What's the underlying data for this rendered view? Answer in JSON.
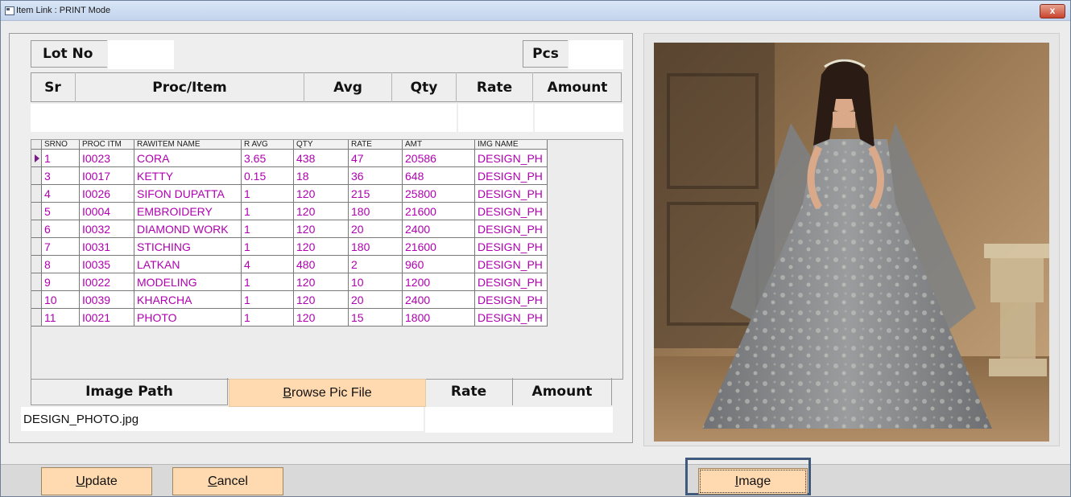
{
  "window": {
    "title": "Item Link : PRINT Mode",
    "close_symbol": "x"
  },
  "form": {
    "lot_no_label": "Lot No",
    "lot_no_value": "",
    "pcs_label": "Pcs",
    "pcs_value": ""
  },
  "header_row": {
    "sr": "Sr",
    "proc_item": "Proc/Item",
    "avg": "Avg",
    "qty": "Qty",
    "rate": "Rate",
    "amount": "Amount"
  },
  "grid": {
    "columns": [
      "SRNO",
      "PROC ITM",
      "RAWITEM NAME",
      "R AVG",
      "QTY",
      "RATE",
      "AMT",
      "IMG NAME"
    ],
    "rows": [
      {
        "srno": "1",
        "proc": "I0023",
        "name": "CORA",
        "avg": "3.65",
        "qty": "438",
        "rate": "47",
        "amt": "20586",
        "img": "DESIGN_PH"
      },
      {
        "srno": "3",
        "proc": "I0017",
        "name": "KETTY",
        "avg": "0.15",
        "qty": "18",
        "rate": "36",
        "amt": "648",
        "img": "DESIGN_PH"
      },
      {
        "srno": "4",
        "proc": "I0026",
        "name": "SIFON DUPATTA",
        "avg": "1",
        "qty": "120",
        "rate": "215",
        "amt": "25800",
        "img": "DESIGN_PH"
      },
      {
        "srno": "5",
        "proc": "I0004",
        "name": "EMBROIDERY",
        "avg": "1",
        "qty": "120",
        "rate": "180",
        "amt": "21600",
        "img": "DESIGN_PH"
      },
      {
        "srno": "6",
        "proc": "I0032",
        "name": "DIAMOND WORK",
        "avg": "1",
        "qty": "120",
        "rate": "20",
        "amt": "2400",
        "img": "DESIGN_PH"
      },
      {
        "srno": "7",
        "proc": "I0031",
        "name": "STICHING",
        "avg": "1",
        "qty": "120",
        "rate": "180",
        "amt": "21600",
        "img": "DESIGN_PH"
      },
      {
        "srno": "8",
        "proc": "I0035",
        "name": "LATKAN",
        "avg": "4",
        "qty": "480",
        "rate": "2",
        "amt": "960",
        "img": "DESIGN_PH"
      },
      {
        "srno": "9",
        "proc": "I0022",
        "name": "MODELING",
        "avg": "1",
        "qty": "120",
        "rate": "10",
        "amt": "1200",
        "img": "DESIGN_PH"
      },
      {
        "srno": "10",
        "proc": "I0039",
        "name": "KHARCHA",
        "avg": "1",
        "qty": "120",
        "rate": "20",
        "amt": "2400",
        "img": "DESIGN_PH"
      },
      {
        "srno": "11",
        "proc": "I0021",
        "name": "PHOTO",
        "avg": "1",
        "qty": "120",
        "rate": "15",
        "amt": "1800",
        "img": "DESIGN_PH"
      }
    ]
  },
  "footer_section": {
    "image_path_label": "Image Path",
    "browse_button": "Browse Pic File",
    "browse_accel": "B",
    "browse_rest": "rowse Pic File",
    "rate_label": "Rate",
    "amount_label": "Amount",
    "image_path_value": "DESIGN_PHOTO.jpg"
  },
  "buttons": {
    "update_accel": "U",
    "update_rest": "pdate",
    "cancel_accel": "C",
    "cancel_rest": "ancel",
    "image_accel": "I",
    "image_rest": "mage"
  },
  "colors": {
    "accent_button": "#ffdab0",
    "grid_text": "#b000b0",
    "focus_border": "#3f5a7d"
  },
  "icons": [
    "app-window-icon",
    "close-icon",
    "row-selector-arrow-icon"
  ]
}
